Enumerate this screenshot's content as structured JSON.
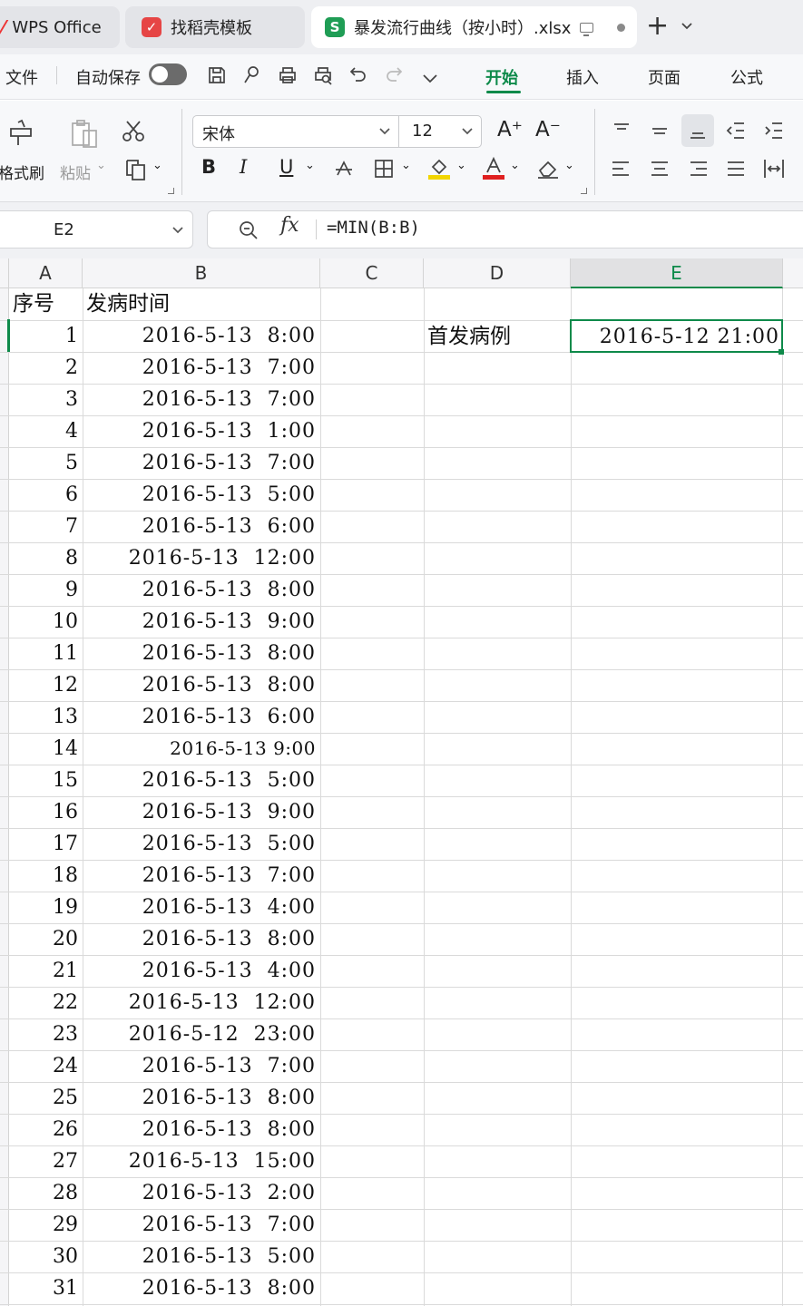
{
  "tabs": [
    {
      "label": "WPS Office"
    },
    {
      "label": "找稻壳模板"
    },
    {
      "label": "暴发流行曲线（按小时）.xlsx"
    }
  ],
  "menu": {
    "file": "文件",
    "autosave": "自动保存",
    "tabs": [
      "开始",
      "插入",
      "页面",
      "公式"
    ]
  },
  "ribbon": {
    "format_painter": "格式刷",
    "paste": "粘贴",
    "font_name": "宋体",
    "font_size": "12",
    "bold": "B",
    "italic": "I",
    "underline": "U"
  },
  "formula_bar": {
    "cell_ref": "E2",
    "formula": "=MIN(B:B)"
  },
  "sheet": {
    "columns": [
      "A",
      "B",
      "C",
      "D",
      "E"
    ],
    "headers": {
      "a": "序号",
      "b": "发病时间"
    },
    "d2_label": "首发病例",
    "e2_value": "2016-5-12 21:00",
    "rows": [
      {
        "n": "1",
        "t": "2016-5-13  8:00"
      },
      {
        "n": "2",
        "t": "2016-5-13  7:00"
      },
      {
        "n": "3",
        "t": "2016-5-13  7:00"
      },
      {
        "n": "4",
        "t": "2016-5-13  1:00"
      },
      {
        "n": "5",
        "t": "2016-5-13  7:00"
      },
      {
        "n": "6",
        "t": "2016-5-13  5:00"
      },
      {
        "n": "7",
        "t": "2016-5-13  6:00"
      },
      {
        "n": "8",
        "t": "2016-5-13  12:00"
      },
      {
        "n": "9",
        "t": "2016-5-13  8:00"
      },
      {
        "n": "10",
        "t": "2016-5-13  9:00"
      },
      {
        "n": "11",
        "t": "2016-5-13  8:00"
      },
      {
        "n": "12",
        "t": "2016-5-13  8:00"
      },
      {
        "n": "13",
        "t": "2016-5-13  6:00"
      },
      {
        "n": "14",
        "t": "2016-5-13 9:00"
      },
      {
        "n": "15",
        "t": "2016-5-13  5:00"
      },
      {
        "n": "16",
        "t": "2016-5-13  9:00"
      },
      {
        "n": "17",
        "t": "2016-5-13  5:00"
      },
      {
        "n": "18",
        "t": "2016-5-13  7:00"
      },
      {
        "n": "19",
        "t": "2016-5-13  4:00"
      },
      {
        "n": "20",
        "t": "2016-5-13  8:00"
      },
      {
        "n": "21",
        "t": "2016-5-13  4:00"
      },
      {
        "n": "22",
        "t": "2016-5-13  12:00"
      },
      {
        "n": "23",
        "t": "2016-5-12  23:00"
      },
      {
        "n": "24",
        "t": "2016-5-13  7:00"
      },
      {
        "n": "25",
        "t": "2016-5-13  8:00"
      },
      {
        "n": "26",
        "t": "2016-5-13  8:00"
      },
      {
        "n": "27",
        "t": "2016-5-13  15:00"
      },
      {
        "n": "28",
        "t": "2016-5-13  2:00"
      },
      {
        "n": "29",
        "t": "2016-5-13  7:00"
      },
      {
        "n": "30",
        "t": "2016-5-13  5:00"
      },
      {
        "n": "31",
        "t": "2016-5-13  8:00"
      }
    ]
  },
  "colors": {
    "accent": "#0e8a4a"
  }
}
